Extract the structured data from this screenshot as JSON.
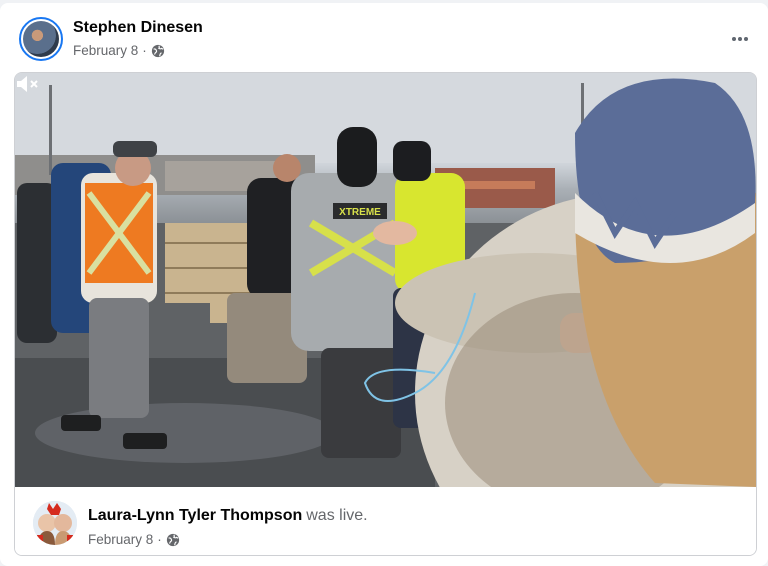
{
  "post": {
    "author_name": "Stephen Dinesen",
    "date": "February 8",
    "separator": "·",
    "privacy_icon": "globe-icon",
    "more_icon": "more-horizontal-icon"
  },
  "video": {
    "mute_icon": "volume-muted-icon",
    "jacket_text": "XTREME"
  },
  "shared": {
    "author_name": "Laura-Lynn Tyler Thompson",
    "status_text": "was live.",
    "date": "February 8",
    "separator": "·",
    "privacy_icon": "globe-icon"
  },
  "colors": {
    "accent": "#1877f2",
    "secondary_text": "#65676b",
    "border": "#ced0d4"
  }
}
